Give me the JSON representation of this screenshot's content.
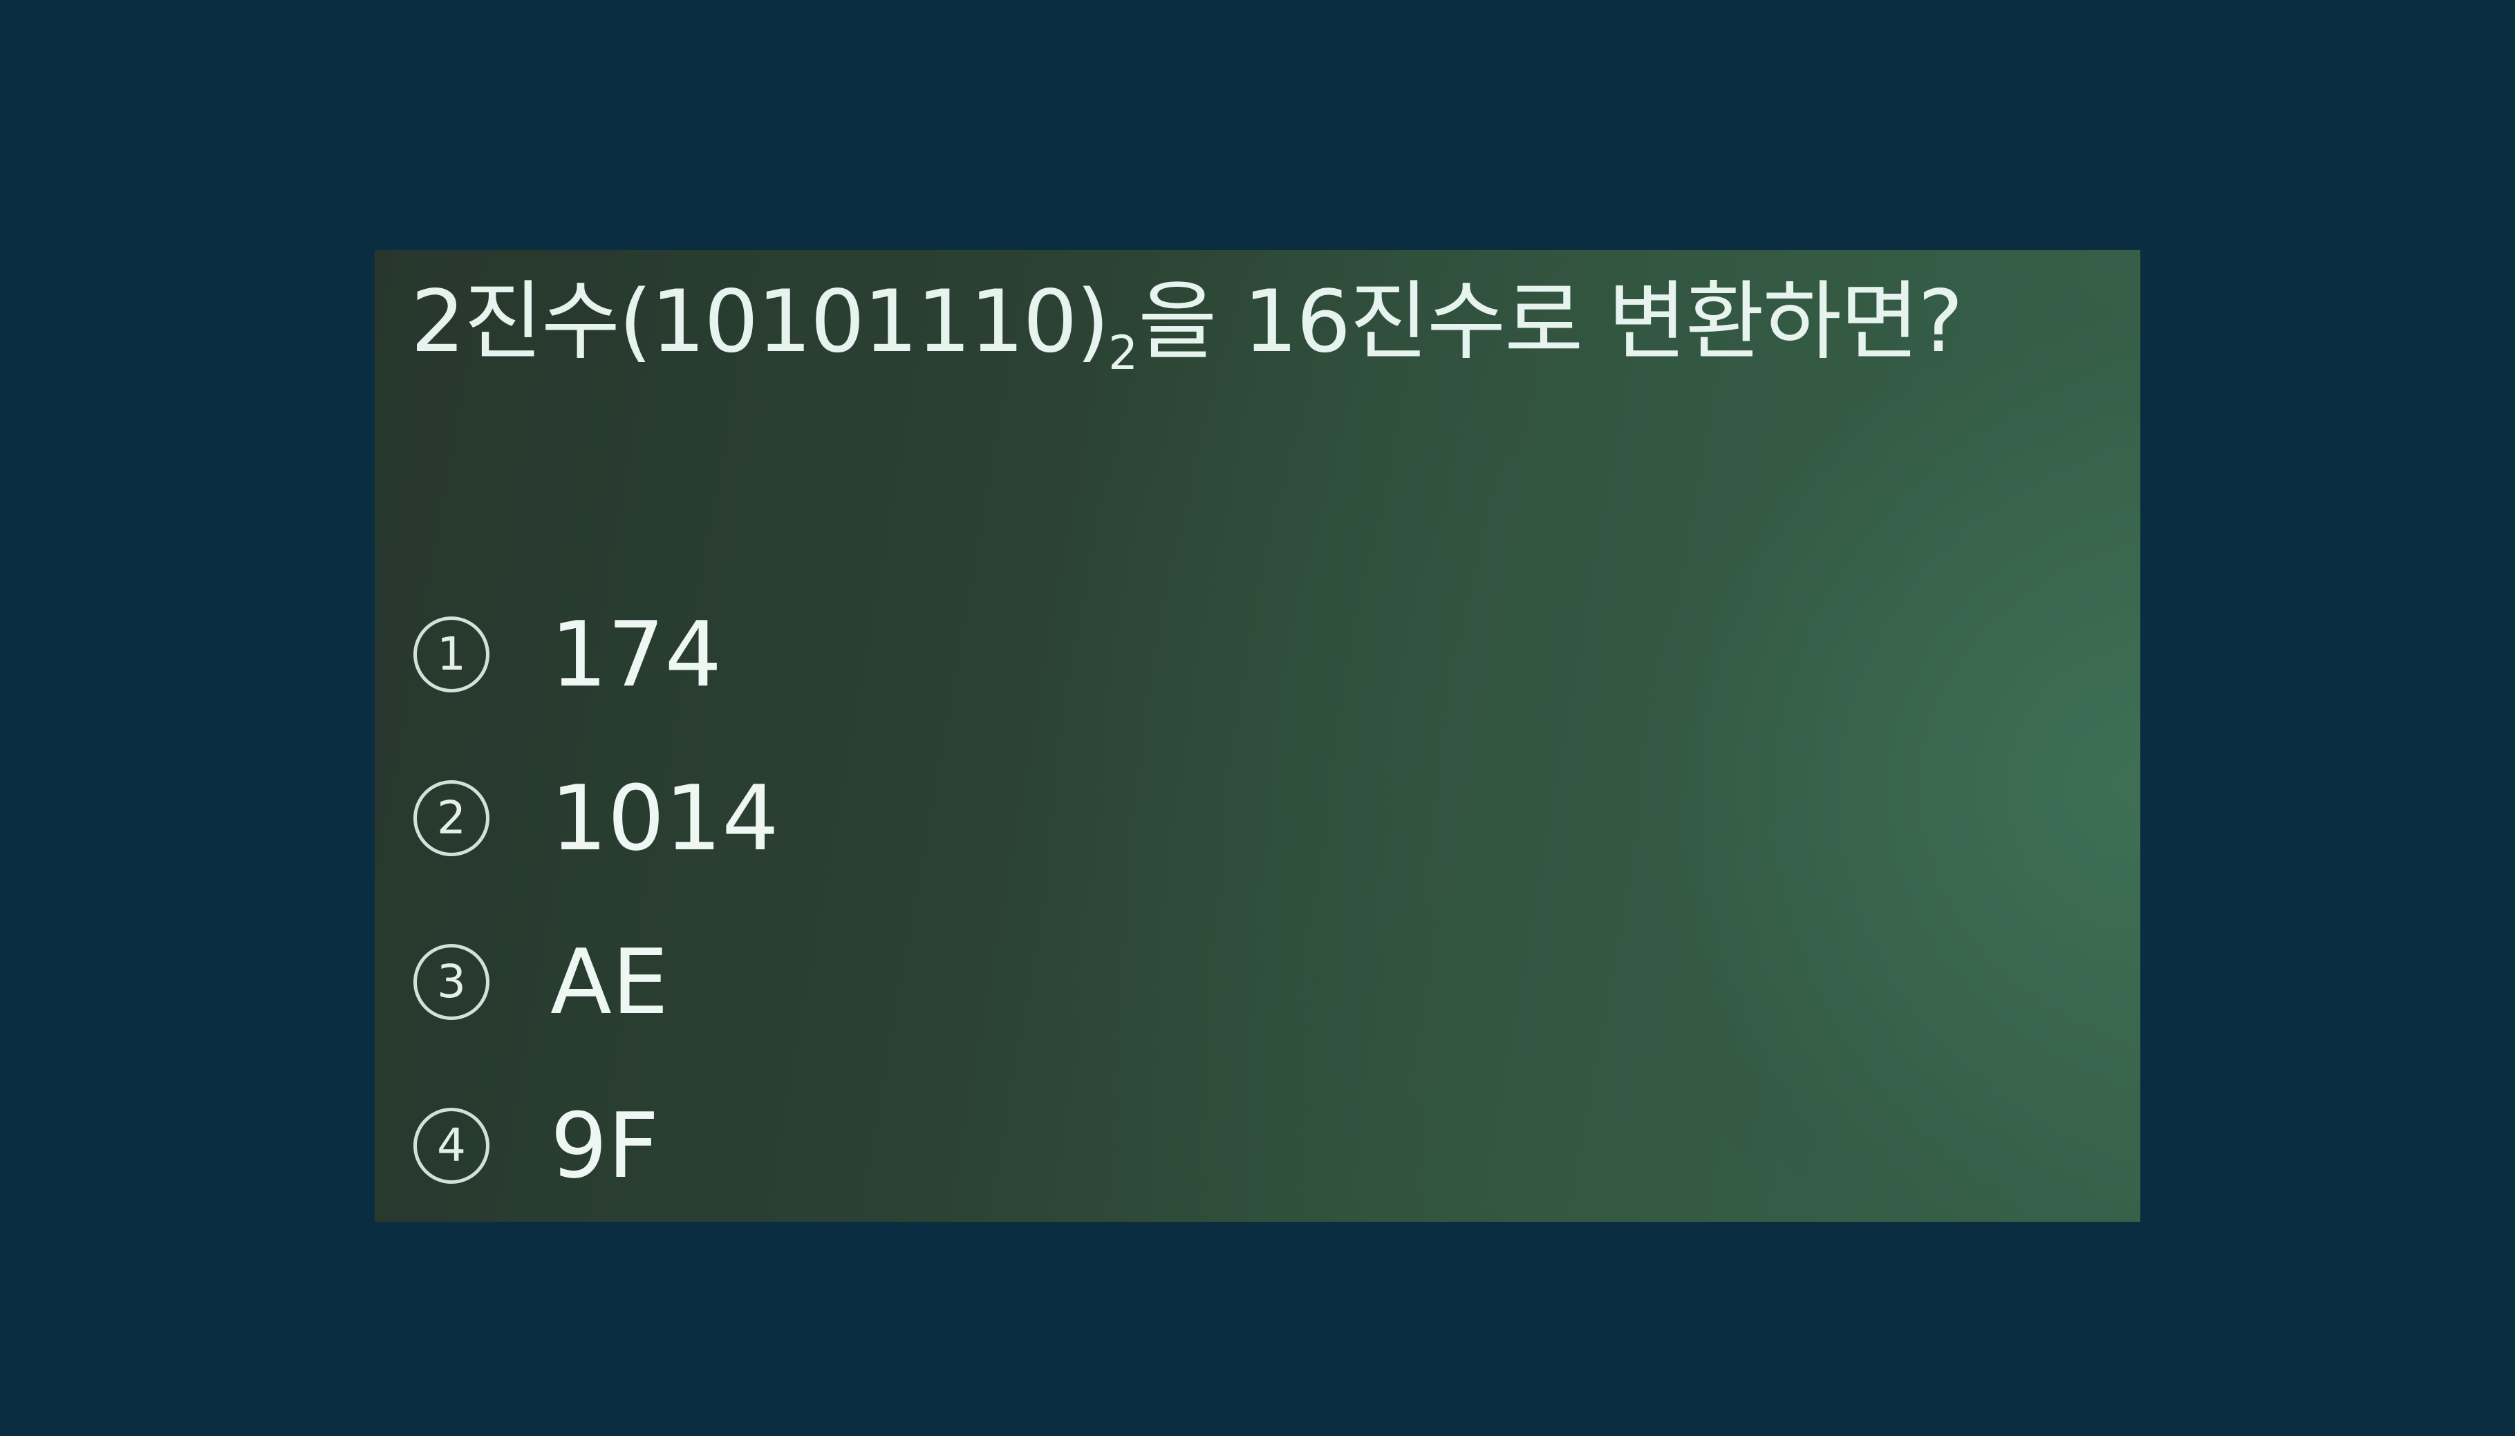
{
  "question": {
    "prefix": "2진수(10101110)",
    "subscript": "2",
    "middle": "을",
    "suffix": "16진수로 변환하면?"
  },
  "options": [
    {
      "marker": "1",
      "text": "174"
    },
    {
      "marker": "2",
      "text": "1014"
    },
    {
      "marker": "3",
      "text": "AE"
    },
    {
      "marker": "4",
      "text": "9F"
    }
  ]
}
